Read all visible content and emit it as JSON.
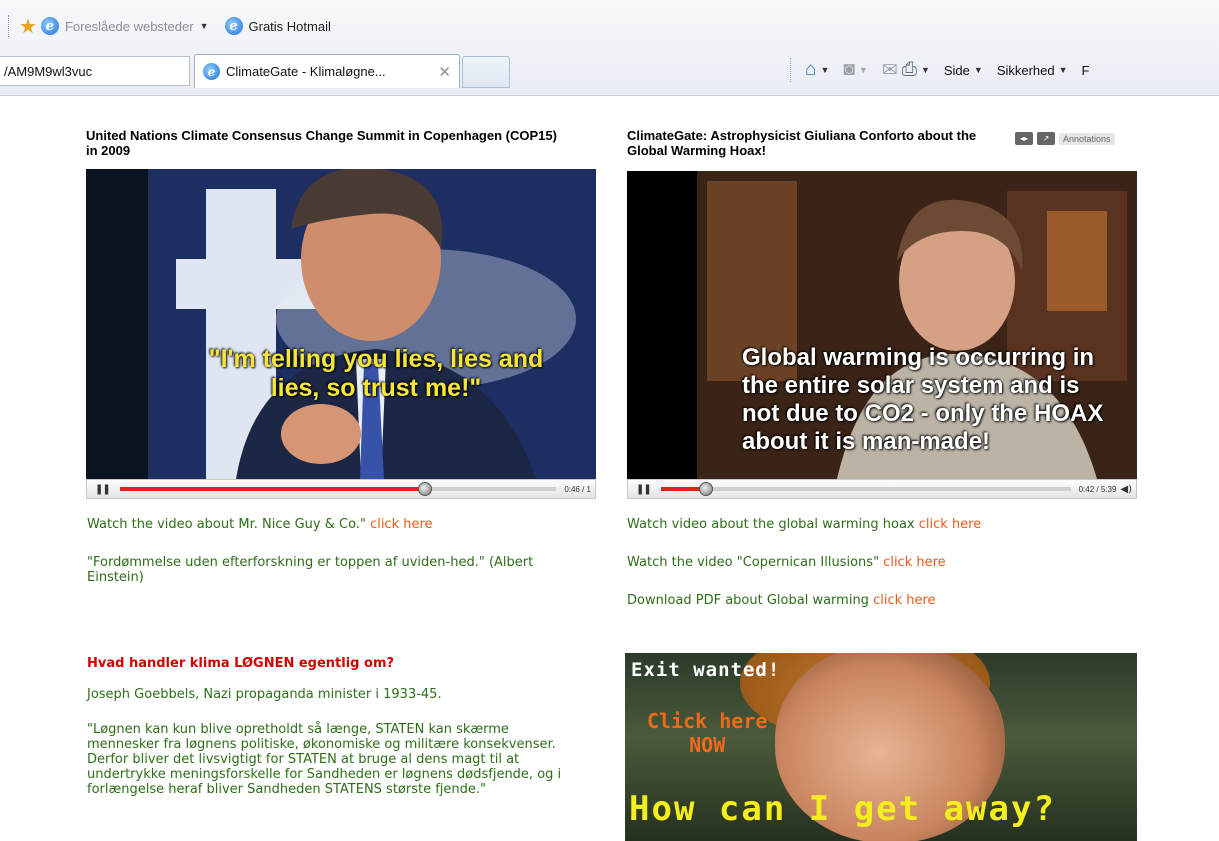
{
  "favorites_bar": {
    "suggested_sites": "Foreslåede websteder",
    "hotmail": "Gratis Hotmail"
  },
  "address": {
    "value": "/AM9M9wl3vuc"
  },
  "tab": {
    "title": "ClimateGate - Klimaløgne..."
  },
  "command_bar": {
    "page": "Side",
    "safety": "Sikkerhed",
    "cut_off": "F"
  },
  "left_video": {
    "title": "United Nations Climate Consensus Change Summit in Copenhagen (COP15) in 2009",
    "caption": "\"I'm telling you lies, lies and lies, so trust me!\"",
    "time": "0:46 / 1",
    "progress": 0.7
  },
  "right_video": {
    "title": "ClimateGate: Astrophysicist Giuliana Conforto about the Global Warming Hoax!",
    "annotations": "Annotations",
    "caption": "Global warming is occurring in the entire solar system and is not due to CO2 - only the HOAX about it is man-made!",
    "time": "0:42 / 5:39",
    "progress": 0.11
  },
  "left_links": {
    "watch_text": "Watch the video about Mr. Nice Guy & Co.\" ",
    "click_here": "click here",
    "quote": "\"Fordømmelse uden efterforskning er toppen af uviden-hed.\" (Albert Einstein)"
  },
  "right_links": [
    {
      "text": "Watch video about the global warming hoax ",
      "link": "click here"
    },
    {
      "text": "Watch the video \"Copernican Illusions\" ",
      "link": "click here"
    },
    {
      "text": "Download PDF about Global warming ",
      "link": "click here"
    }
  ],
  "lower_left": {
    "heading": "Hvad handler klima LØGNEN egentlig om?",
    "attribution": "Joseph Goebbels, Nazi propaganda minister i 1933-45.",
    "quote": "\"Løgnen kan kun blive opretholdt så længe, STATEN kan skærme mennesker fra løgnens politiske, økonomiske og militære konsekvenser. Derfor bliver det livsvigtigt for STATEN at bruge al dens magt til at undertrykke meningsforskelle for Sandheden er løgnens dødsfjende, og i forlængelse heraf bliver Sandheden STATENS største fjende.\""
  },
  "banner": {
    "exit": "Exit wanted!",
    "click_here": "Click here",
    "now": "NOW",
    "how": "How can I get away?"
  }
}
